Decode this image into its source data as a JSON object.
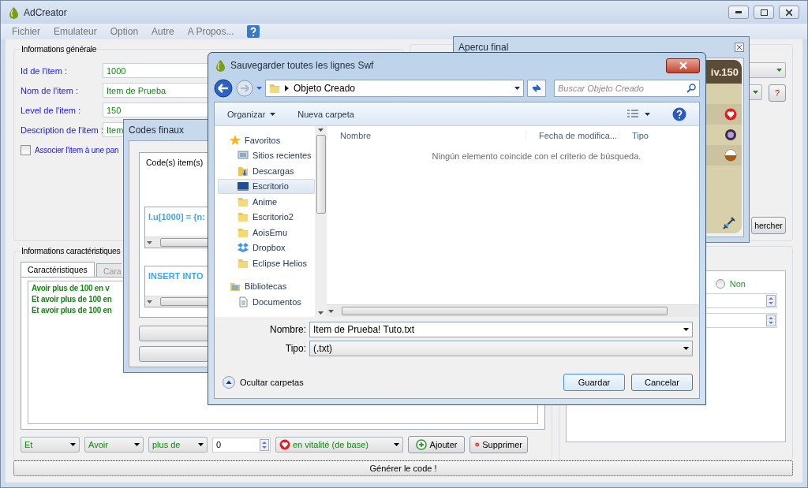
{
  "app": {
    "title": "AdCreator"
  },
  "menu": [
    {
      "label": "Fichier"
    },
    {
      "label": "Emulateur"
    },
    {
      "label": "Option"
    },
    {
      "label": "Autre"
    },
    {
      "label": "A Propos..."
    }
  ],
  "general": {
    "title": "Informations générale",
    "fields": [
      {
        "label": "Id de l'item :",
        "value": "1000"
      },
      {
        "label": "Nom de l'item :",
        "value": "Item de Prueba"
      },
      {
        "label": "Level de l'item :",
        "value": "150"
      },
      {
        "label": "Description de l'item :",
        "value": "Item"
      }
    ],
    "pano": {
      "label": "Associer l'item à une pan",
      "checked": false
    }
  },
  "search_panel": {
    "help_button": "?",
    "search_button": "hercher"
  },
  "characteristics": {
    "title": "Informations caractéristiques",
    "tabs": [
      {
        "label": "Caractéristiques",
        "selected": true
      },
      {
        "label": "Cara",
        "selected": false
      }
    ],
    "lines": [
      "Avoir plus de 100 en v",
      "Et avoir plus de 100 en",
      "Et avoir plus de 100 en"
    ],
    "connector": "Et",
    "verb": "Avoir",
    "comparison": "plus de",
    "amount": "0",
    "stat": "en vitalité (de base)",
    "add_button": "Ajouter",
    "remove_button": "Supprimer"
  },
  "options": {
    "radio": {
      "label": "Non",
      "selected": false
    }
  },
  "generate_button": "Générer le code !",
  "preview_window": {
    "title": "Apercu final",
    "level_text": "iv.150"
  },
  "codes_window": {
    "title": "Codes finaux",
    "tab": "Code(s) item(s)",
    "outputs": [
      "I.u[1000] = {n:",
      "INSERT INTO"
    ]
  },
  "save_dialog": {
    "title": "Sauvegarder toutes les lignes Swf",
    "path": "Objeto Creado",
    "search_placeholder": "Buscar Objeto Creado",
    "toolbar": [
      "Organizar",
      "Nueva carpeta"
    ],
    "nav": [
      {
        "label": "Favoritos",
        "kind": "favorites",
        "selected": false,
        "children": [
          {
            "label": "Sitios recientes",
            "kind": "recent",
            "selected": false
          },
          {
            "label": "Descargas",
            "kind": "downloads",
            "selected": false
          },
          {
            "label": "Escritorio",
            "kind": "desktop",
            "selected": true
          },
          {
            "label": "Anime",
            "kind": "folder",
            "selected": false
          },
          {
            "label": "Escritorio2",
            "kind": "folder",
            "selected": false
          },
          {
            "label": "AoisEmu",
            "kind": "folder",
            "selected": false
          },
          {
            "label": "Dropbox",
            "kind": "dropbox",
            "selected": false
          },
          {
            "label": "Eclipse Helios",
            "kind": "folder",
            "selected": false
          }
        ]
      },
      {
        "label": "Bibliotecas",
        "kind": "libraries",
        "selected": false,
        "children": [
          {
            "label": "Documentos",
            "kind": "documents",
            "selected": false
          }
        ]
      }
    ],
    "columns": [
      "Nombre",
      "Fecha de modifica...",
      "Tipo"
    ],
    "empty_message": "Ningún elemento coincide con el criterio de búsqueda.",
    "name_label": "Nombre:",
    "name_value": "Item de Prueba! Tuto.txt",
    "type_label": "Tipo:",
    "type_value": "(.txt)",
    "hide_folders": "Ocultar carpetas",
    "save_button": "Guardar",
    "cancel_button": "Cancelar"
  }
}
